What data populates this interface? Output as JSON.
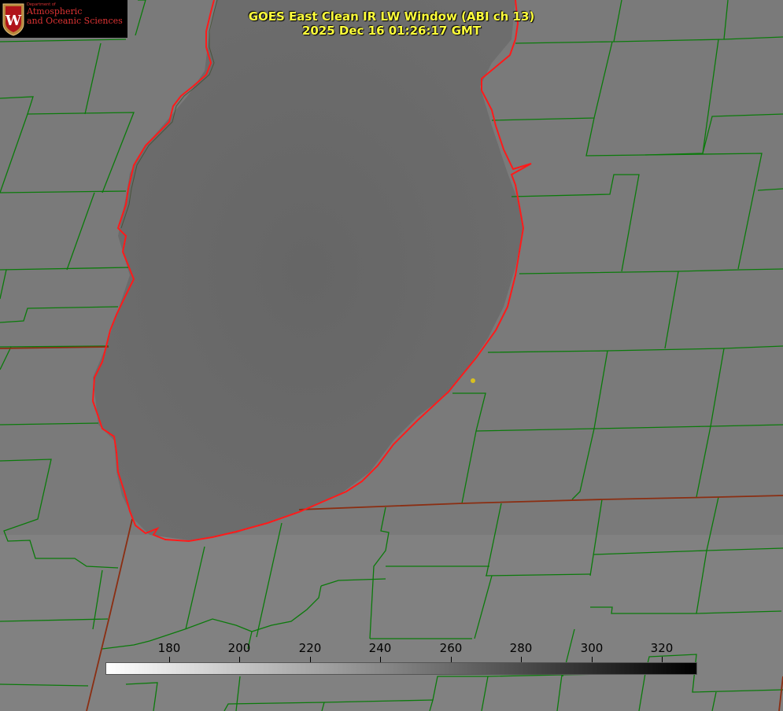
{
  "logo": {
    "dept_small": "Department of",
    "dept_line1": "Atmospheric",
    "dept_line2": "and Oceanic Sciences",
    "seal_letter": "W"
  },
  "title": {
    "line1": "GOES East Clean IR LW Window (ABI ch 13)",
    "line2": "2025 Dec 16 01:26:17 GMT"
  },
  "colorbar": {
    "ticks": [
      "180",
      "200",
      "220",
      "240",
      "260",
      "280",
      "300",
      "320"
    ]
  },
  "colors": {
    "county_lines": "#0b7a0b",
    "coastline": "#ff1a1a",
    "state_lines": "#8b2e12",
    "title_text": "#ffff3c",
    "marker": "#d8c020"
  }
}
